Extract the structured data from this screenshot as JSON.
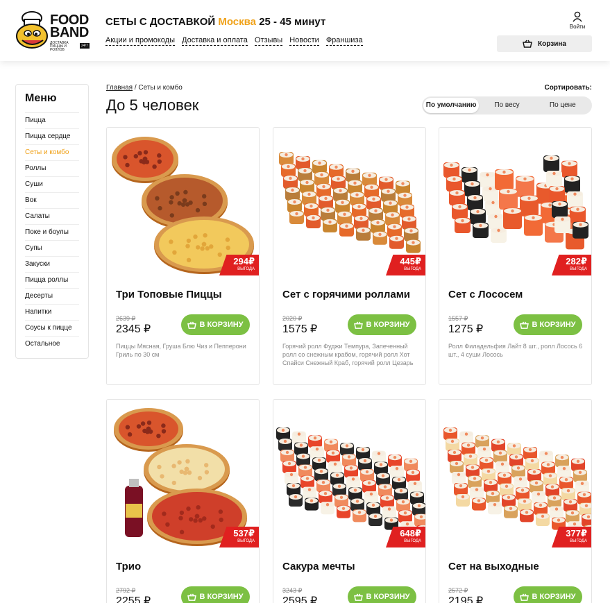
{
  "header": {
    "logo_line1": "FOOD",
    "logo_line2": "BAND",
    "logo_sub": "ДОСТАВКА ПИЦЦЫ И РОЛЛОВ",
    "logo_badge": "24/7",
    "title_prefix": "СЕТЫ С ДОСТАВКОЙ",
    "city": "Москва",
    "delivery_time": "25 - 45 минут",
    "nav": [
      "Акции и промокоды",
      "Доставка и оплата",
      "Отзывы",
      "Новости",
      "Франшиза"
    ],
    "login_label": "Войти",
    "cart_label": "Корзина"
  },
  "sidebar": {
    "title": "Меню",
    "active": "Сеты и комбо",
    "items": [
      "Пицца",
      "Пицца сердце",
      "Сеты и комбо",
      "Роллы",
      "Суши",
      "Вок",
      "Салаты",
      "Поке и боулы",
      "Супы",
      "Закуски",
      "Пицца роллы",
      "Десерты",
      "Напитки",
      "Соусы к пицце",
      "Остальное"
    ]
  },
  "breadcrumb": {
    "home": "Главная",
    "separator": " / ",
    "current": "Сеты и комбо"
  },
  "page_title": "До 5 человек",
  "sort": {
    "label": "Сортировать:",
    "options": [
      "По умолчанию",
      "По весу",
      "По цене"
    ],
    "active": "По умолчанию"
  },
  "colors": {
    "accent": "#f0a21a",
    "button_green": "#7cc043",
    "savings_red": "#e02020"
  },
  "buy_label": "В КОРЗИНУ",
  "savings_label": "ВЫГОДА",
  "products": [
    {
      "name": "Три Топовые Пиццы",
      "old_price": "2639 ₽",
      "price": "2345 ₽",
      "savings": "294₽",
      "description": "Пиццы Мясная, Груша Блю Чиз и Пепперони Гриль по 30 см",
      "image": "three-pizzas"
    },
    {
      "name": "Сет с горячими роллами",
      "old_price": "2020 ₽",
      "price": "1575 ₽",
      "savings": "445₽",
      "description": "Горячий ролл Фуджи Темпура, Запеченный ролл со снежным крабом, горячий ролл Хот Спайси Снежный Краб, горячий ролл Цезарь",
      "image": "hot-rolls"
    },
    {
      "name": "Сет с Лососем",
      "old_price": "1557 ₽",
      "price": "1275 ₽",
      "savings": "282₽",
      "description": "Ролл Филадельфия Лайт 8 шт., ролл Лосось 6 шт., 4 суши Лосось",
      "image": "salmon-set"
    },
    {
      "name": "Трио",
      "old_price": "2792 ₽",
      "price": "2255 ₽",
      "savings": "537₽",
      "description": "",
      "image": "trio-pizzas-drink"
    },
    {
      "name": "Сакура мечты",
      "old_price": "3243 ₽",
      "price": "2595 ₽",
      "savings": "648₽",
      "description": "",
      "image": "sakura-rolls"
    },
    {
      "name": "Сет на выходные",
      "old_price": "2572 ₽",
      "price": "2195 ₽",
      "savings": "377₽",
      "description": "",
      "image": "weekend-rolls"
    }
  ]
}
